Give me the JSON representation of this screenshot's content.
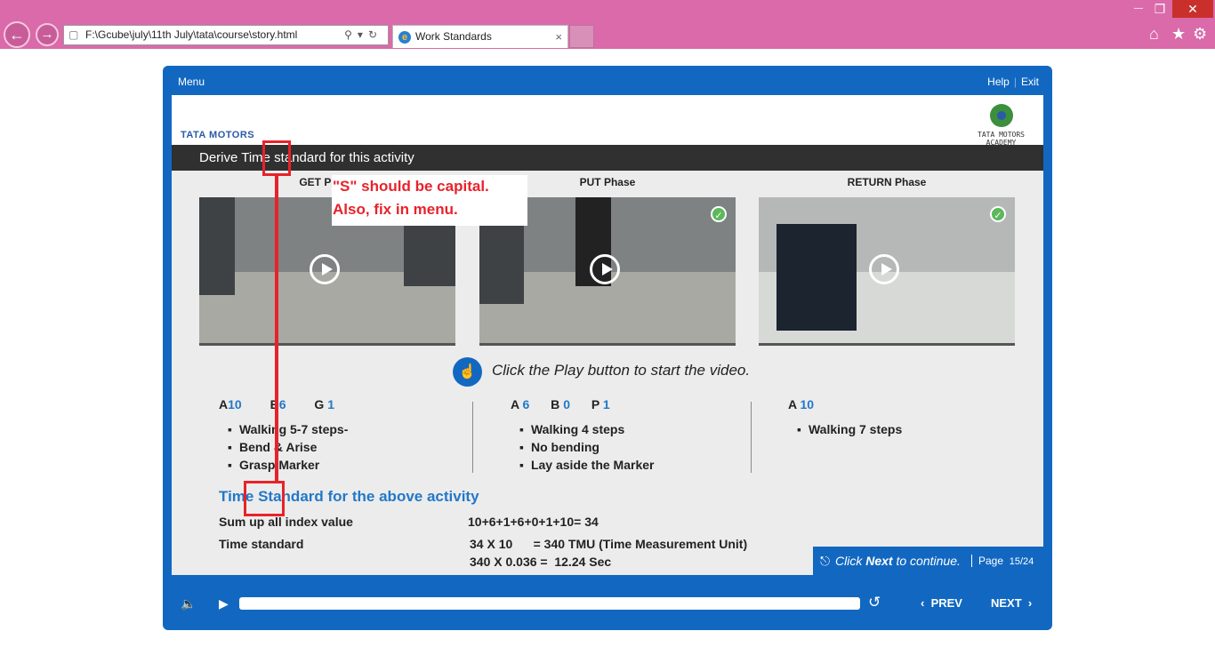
{
  "browser": {
    "address": "F:\\Gcube\\july\\11th July\\tata\\course\\story.html",
    "tab_title": "Work Standards",
    "tab_close": "×",
    "win_minimize": "—",
    "win_restore": "❐",
    "win_close": "✕"
  },
  "player": {
    "menu": "Menu",
    "help": "Help",
    "separator": "|",
    "exit": "Exit"
  },
  "slide": {
    "brand_left": "TATA MOTORS",
    "brand_right": "TATA MOTORS ACADEMY",
    "title": "Derive Time standard for this activity",
    "phases": [
      {
        "label": "GET Phase",
        "completed": false
      },
      {
        "label": "PUT Phase",
        "completed": true
      },
      {
        "label": "RETURN Phase",
        "completed": true
      }
    ],
    "instruction": "Click the Play button to start the video.",
    "columns": [
      {
        "indices": [
          {
            "letter": "A",
            "value": "10"
          },
          {
            "letter": "B",
            "value": "6"
          },
          {
            "letter": "G",
            "value": "1"
          }
        ],
        "bullets": [
          "Walking 5-7 steps-",
          "Bend & Arise",
          "Grasp Marker"
        ]
      },
      {
        "indices": [
          {
            "letter": "A",
            "value": "6"
          },
          {
            "letter": "B",
            "value": "0"
          },
          {
            "letter": "P",
            "value": "1"
          }
        ],
        "bullets": [
          "Walking 4 steps",
          "No bending",
          "Lay aside the Marker"
        ]
      },
      {
        "indices": [
          {
            "letter": "A",
            "value": "10"
          }
        ],
        "bullets": [
          "Walking 7 steps"
        ]
      }
    ],
    "ts_heading": "Time Standard for the above activity",
    "sum_label": "Sum up all index value",
    "sum_value": "10+6+1+6+0+1+10= 34",
    "ts_label": "Time standard",
    "ts_line1": "34 X 10      = 340 TMU (Time Measurement Unit)",
    "ts_line2": "340 X 0.036 =  12.24 Sec",
    "next_hint_prefix": "Click ",
    "next_hint_bold": "Next",
    "next_hint_suffix": " to continue.",
    "page_label": "Page",
    "page_value": "15/24"
  },
  "annotation": {
    "line1": "\"S\" should be capital.",
    "line2": "Also, fix in menu."
  },
  "controls": {
    "prev": "PREV",
    "next": "NEXT",
    "progress": 0
  },
  "colors": {
    "player_blue": "#1268c1",
    "annotation_red": "#e8222b",
    "index_blue": "#2378c8"
  }
}
